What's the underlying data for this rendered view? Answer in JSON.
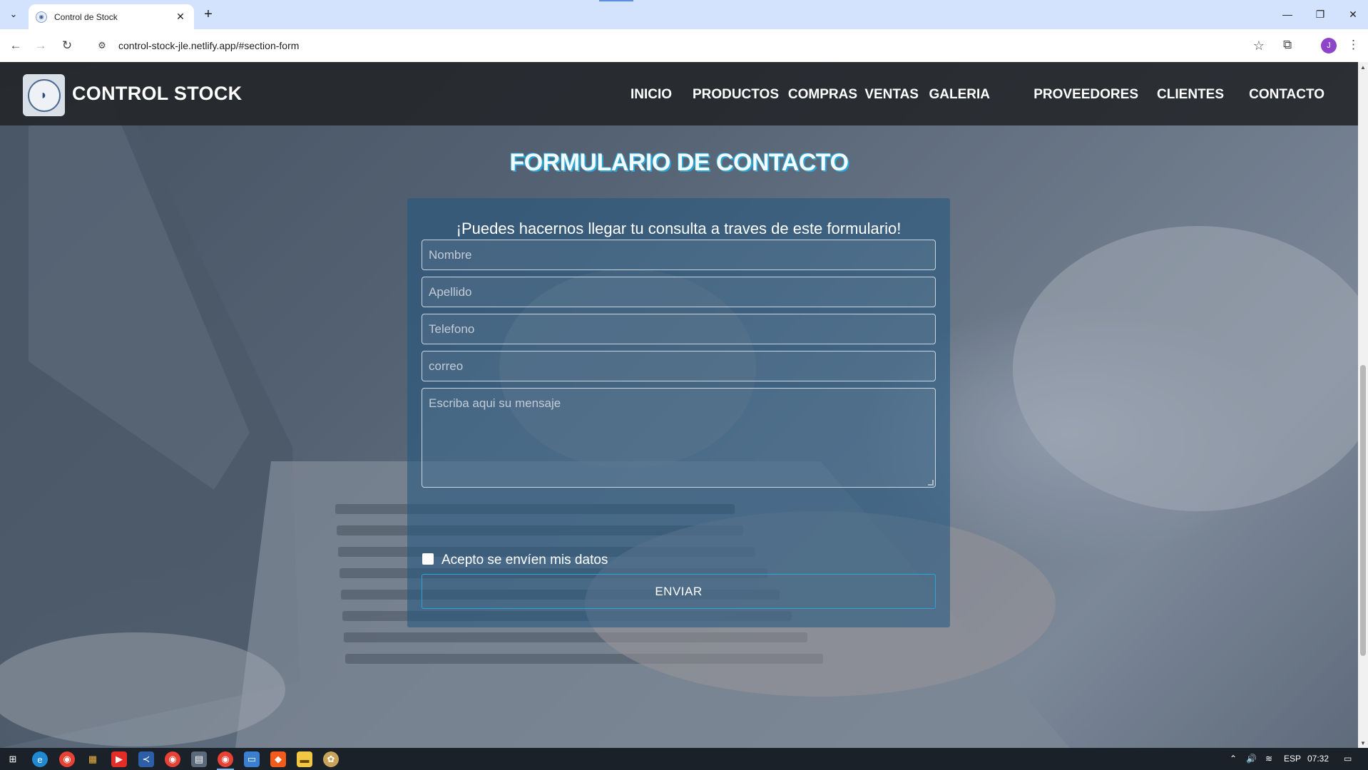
{
  "browser": {
    "tab_title": "Control de Stock",
    "url": "control-stock-jle.netlify.app/#section-form",
    "profile_initial": "J"
  },
  "site": {
    "brand": "CONTROL STOCK",
    "nav": [
      "INICIO",
      "PRODUCTOS",
      "COMPRAS",
      "VENTAS",
      "GALERIA",
      "PROVEEDORES",
      "CLIENTES",
      "CONTACTO"
    ]
  },
  "form": {
    "title": "FORMULARIO DE CONTACTO",
    "subtitle": "¡Puedes hacernos llegar tu consulta a traves de este formulario!",
    "fields": {
      "nombre": "Nombre",
      "apellido": "Apellido",
      "telefono": "Telefono",
      "correo": "correo",
      "mensaje": "Escriba aqui su mensaje"
    },
    "consent_label": "Acepto se envíen mis datos",
    "submit_label": "ENVIAR"
  },
  "taskbar": {
    "language": "ESP",
    "time": "07:32"
  },
  "colors": {
    "tab_strip": "#d3e3fd",
    "header_bg": "#222428",
    "form_card": "#205580",
    "accent": "#2aa6d6"
  }
}
